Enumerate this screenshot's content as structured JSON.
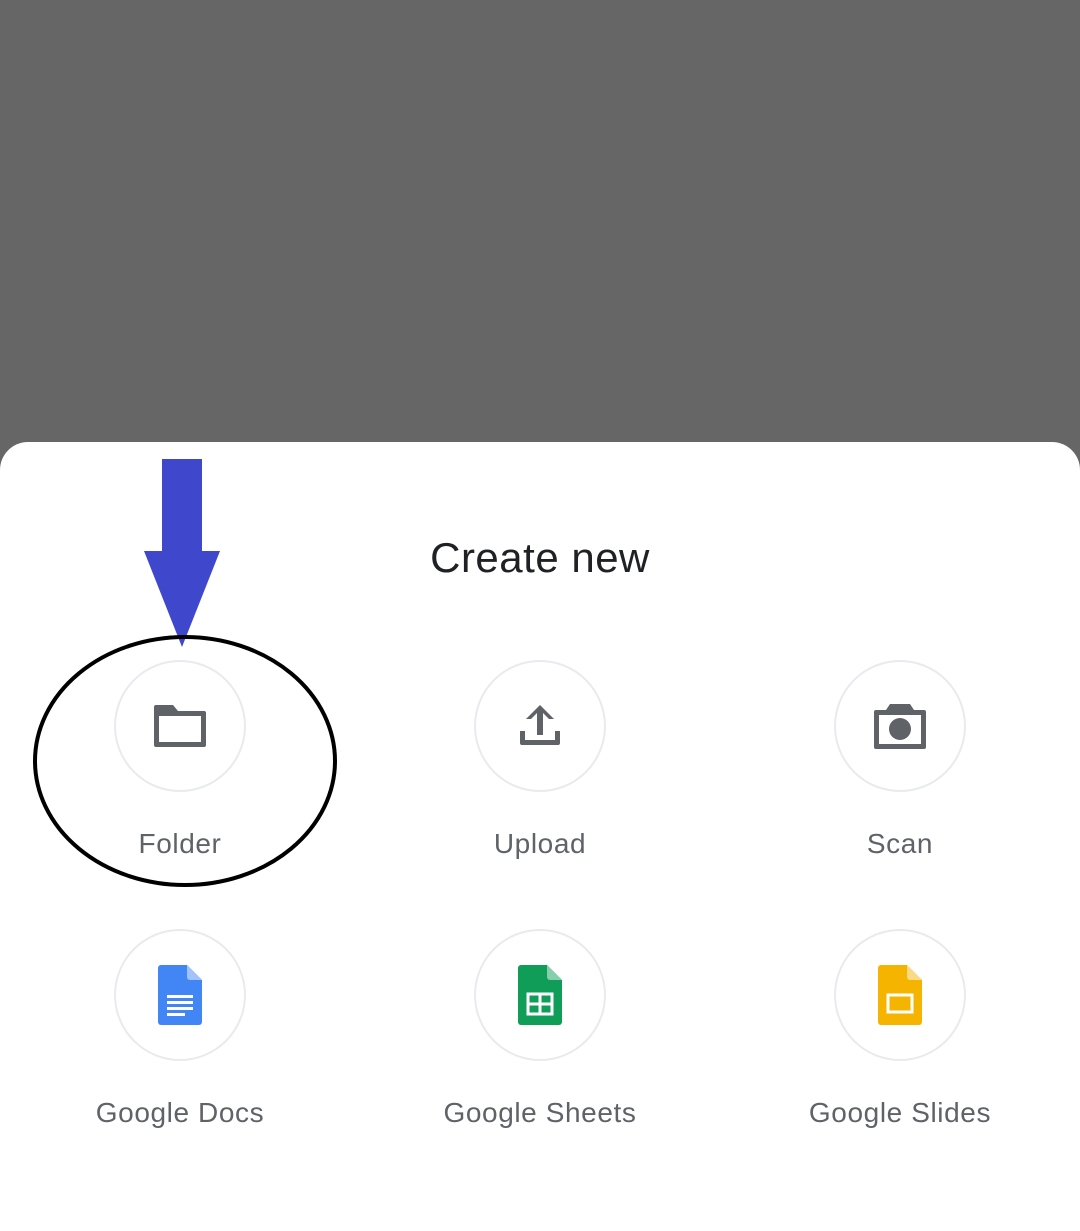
{
  "sheet": {
    "title": "Create new"
  },
  "options": {
    "folder": {
      "label": "Folder",
      "icon": "folder-icon"
    },
    "upload": {
      "label": "Upload",
      "icon": "upload-icon"
    },
    "scan": {
      "label": "Scan",
      "icon": "camera-icon"
    },
    "docs": {
      "label": "Google Docs",
      "icon": "google-docs-icon"
    },
    "sheets": {
      "label": "Google Sheets",
      "icon": "google-sheets-icon"
    },
    "slides": {
      "label": "Google Slides",
      "icon": "google-slides-icon"
    }
  },
  "colors": {
    "scrim": "#666666",
    "icon_gray": "#5f6368",
    "docs_blue": "#4285f4",
    "sheets_green": "#0f9d58",
    "slides_yellow": "#f4b400",
    "annotation_arrow": "#3f48cc",
    "annotation_circle": "#000000"
  }
}
